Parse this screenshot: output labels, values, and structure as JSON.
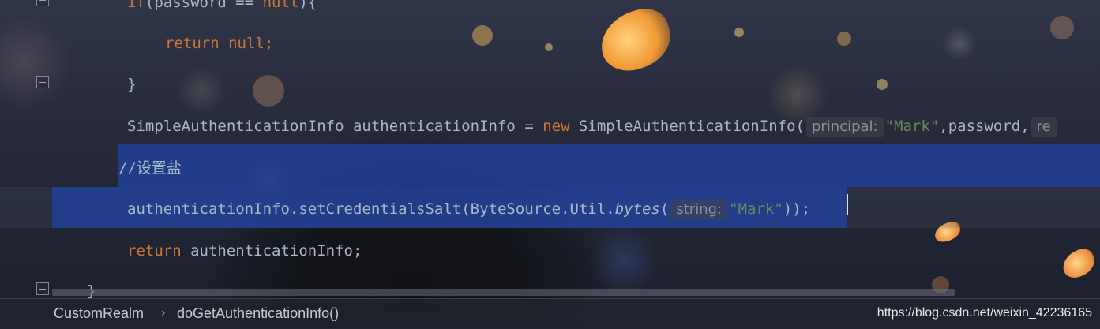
{
  "editor": {
    "lines": {
      "if_kw": "if",
      "if_rest": "(password == ",
      "if_null": "null",
      "if_close": "){",
      "return_kw": "return",
      "return_null": "null",
      "semicolon": ";",
      "brace_close": "}",
      "decl_type": "SimpleAuthenticationInfo authenticationInfo = ",
      "decl_new": "new",
      "decl_ctor": " SimpleAuthenticationInfo(",
      "hint_principal": "principal:",
      "str_mark": "\"Mark\"",
      "decl_password": ",password,",
      "hint_re": "re",
      "comment": "//设置盐",
      "salt_call": "authenticationInfo.setCredentialsSalt(ByteSource.Util.",
      "salt_bytes": "bytes",
      "open_paren": "(",
      "hint_string": "string:",
      "salt_close": "));",
      "return_info": " authenticationInfo;",
      "method_close": "}"
    },
    "colors": {
      "keyword": "#cc7832",
      "string": "#6a8759",
      "text": "#a9b7c6",
      "selection": "#21429c"
    }
  },
  "statusbar": {
    "breadcrumb_class": "CustomRealm",
    "breadcrumb_separator": "›",
    "breadcrumb_method": "doGetAuthenticationInfo()",
    "watermark": "https://blog.csdn.net/weixin_42236165"
  },
  "icons": [
    "fold-marker-icon"
  ]
}
